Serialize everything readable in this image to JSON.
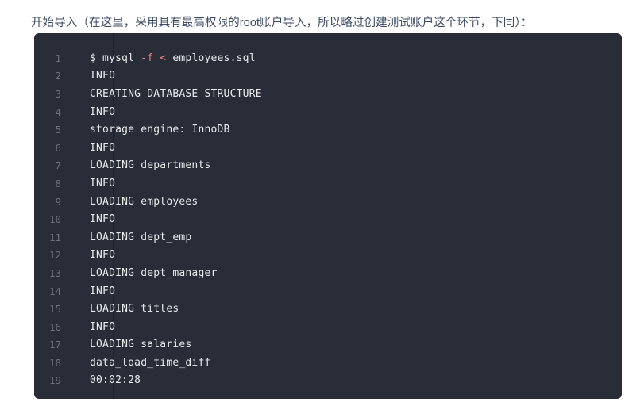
{
  "intro": {
    "text": "开始导入（在这里，采用具有最高权限的root账户导入，所以略过创建测试账户这个环节，下同）："
  },
  "code_block": {
    "language": "shell-session",
    "background_color": "#282d37",
    "text_color": "#e8eaed",
    "line_number_color": "#6b7280",
    "operator_color": "#e6837f",
    "lines": [
      {
        "number": "1",
        "text": "$ mysql -f < employees.sql"
      },
      {
        "number": "2",
        "text": "INFO"
      },
      {
        "number": "3",
        "text": "CREATING DATABASE STRUCTURE"
      },
      {
        "number": "4",
        "text": "INFO"
      },
      {
        "number": "5",
        "text": "storage engine: InnoDB"
      },
      {
        "number": "6",
        "text": "INFO"
      },
      {
        "number": "7",
        "text": "LOADING departments"
      },
      {
        "number": "8",
        "text": "INFO"
      },
      {
        "number": "9",
        "text": "LOADING employees"
      },
      {
        "number": "10",
        "text": "INFO"
      },
      {
        "number": "11",
        "text": "LOADING dept_emp"
      },
      {
        "number": "12",
        "text": "INFO"
      },
      {
        "number": "13",
        "text": "LOADING dept_manager"
      },
      {
        "number": "14",
        "text": "INFO"
      },
      {
        "number": "15",
        "text": "LOADING titles"
      },
      {
        "number": "16",
        "text": "INFO"
      },
      {
        "number": "17",
        "text": "LOADING salaries"
      },
      {
        "number": "18",
        "text": "data_load_time_diff"
      },
      {
        "number": "19",
        "text": "00:02:28"
      }
    ]
  }
}
